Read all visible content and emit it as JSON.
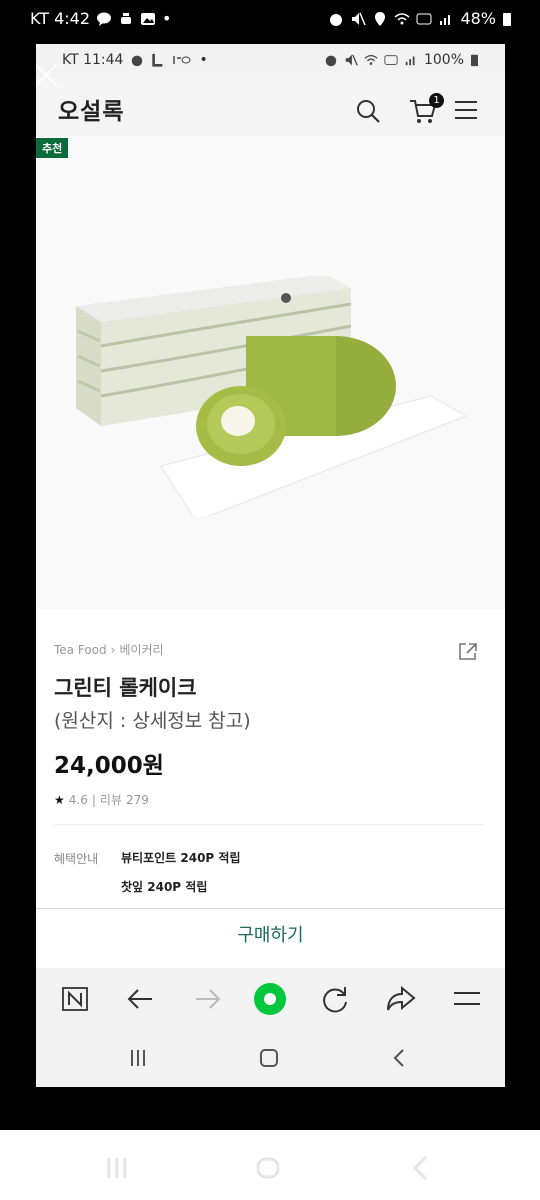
{
  "outer_status": {
    "carrier_time": "KT 4:42",
    "battery": "48%"
  },
  "inner_status": {
    "carrier_time": "KT 11:44",
    "battery": "100%"
  },
  "header": {
    "logo": "오설록",
    "cart_count": "1"
  },
  "product": {
    "badge": "추천",
    "breadcrumb": [
      "Tea Food",
      "베이커리"
    ],
    "name": "그린티 롤케이크",
    "origin": "(원산지 : 상세정보 참고)",
    "price": "24,000원",
    "rating": "4.6",
    "review_label": "리뷰",
    "review_count": "279"
  },
  "benefit": {
    "label": "혜택안내",
    "line1": "뷰티포인트 240P 적립",
    "line2": "찻잎 240P 적립"
  },
  "buy_button": "구매하기",
  "colors": {
    "brand_green": "#0b6b3a",
    "buy_text": "#1d6b5a",
    "browser_home": "#00c73c"
  }
}
